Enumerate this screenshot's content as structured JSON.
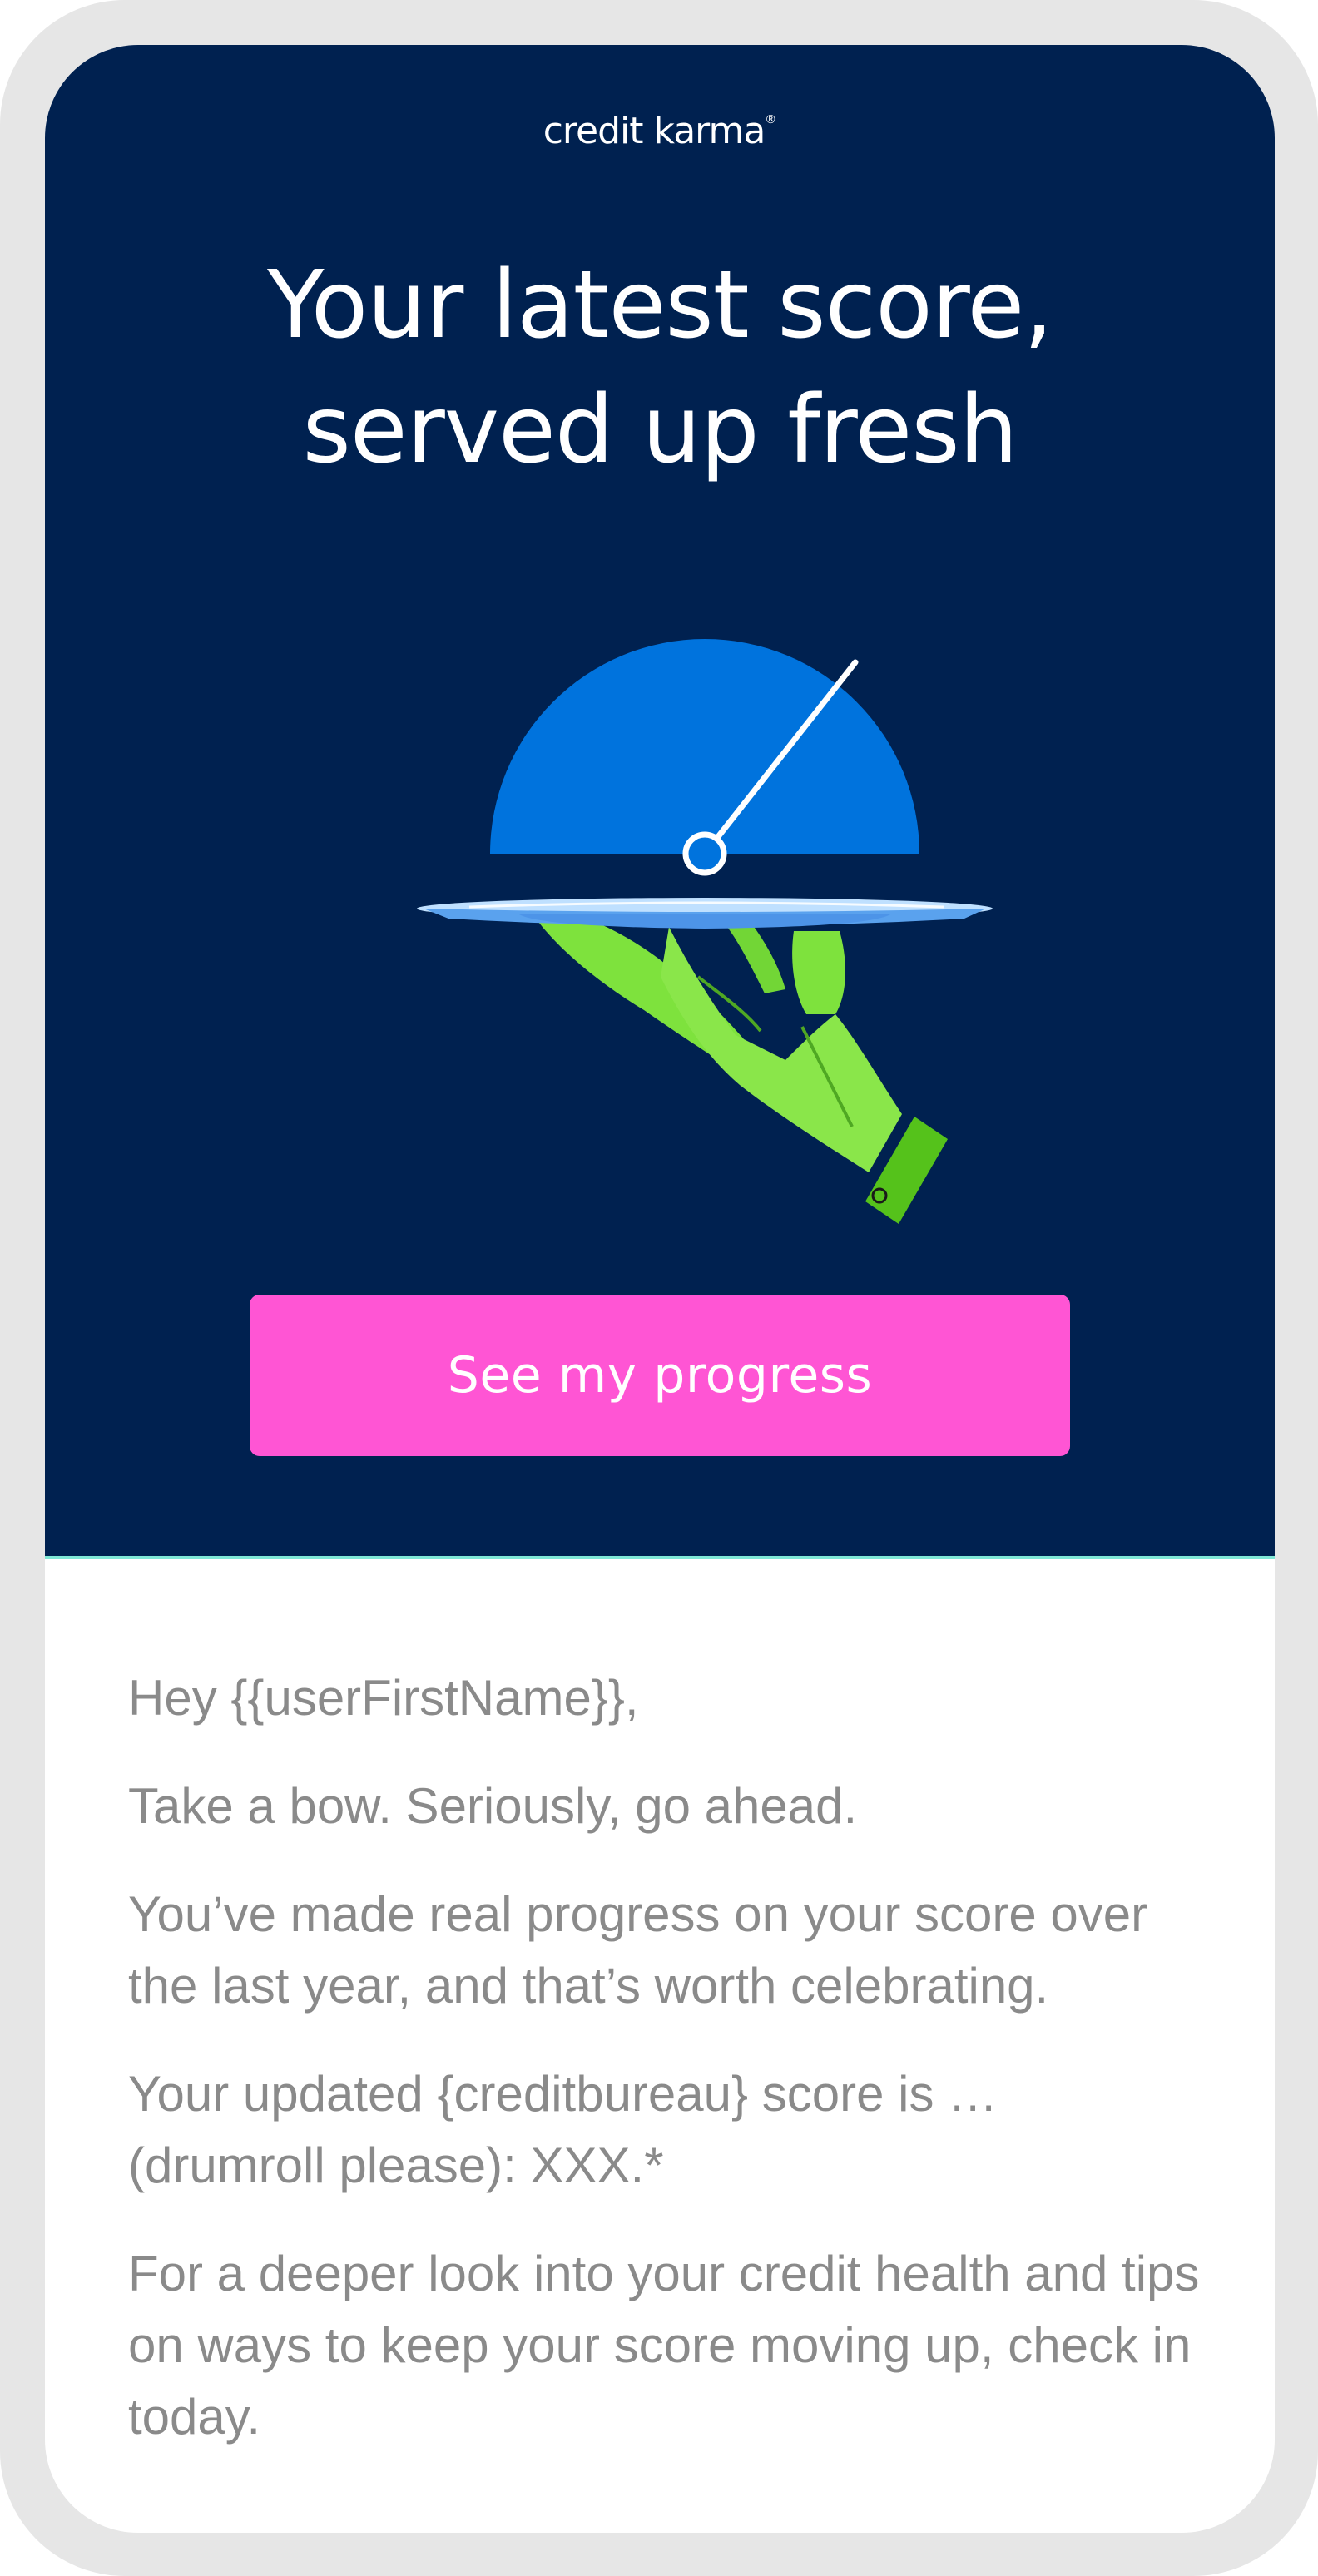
{
  "brand": {
    "logo_text": "credit karma",
    "logo_mark": "®"
  },
  "hero": {
    "headline_line1": "Your latest score,",
    "headline_line2": "served up fresh",
    "cta_label": "See my progress"
  },
  "email_body": {
    "greeting": "Hey {{userFirstName}},",
    "paragraphs": [
      "Take a bow. Seriously, go ahead.",
      "You’ve made real progress on your score over the last year, and that’s worth celebrating.",
      "Your updated {creditbureau} score is … (drumroll please): XXX.*",
      "For a deeper look into your credit health and tips on ways to keep your score moving up, check in today."
    ]
  },
  "icons": {
    "illustration": "score-gauge-on-serving-tray-icon"
  },
  "colors": {
    "hero_background": "#002150",
    "cta_background": "#ff55d4",
    "gauge_blue": "#0073dd",
    "hand_green": "#7fe13f",
    "body_text": "#8a8a8a",
    "frame": "#e6e6e6"
  }
}
